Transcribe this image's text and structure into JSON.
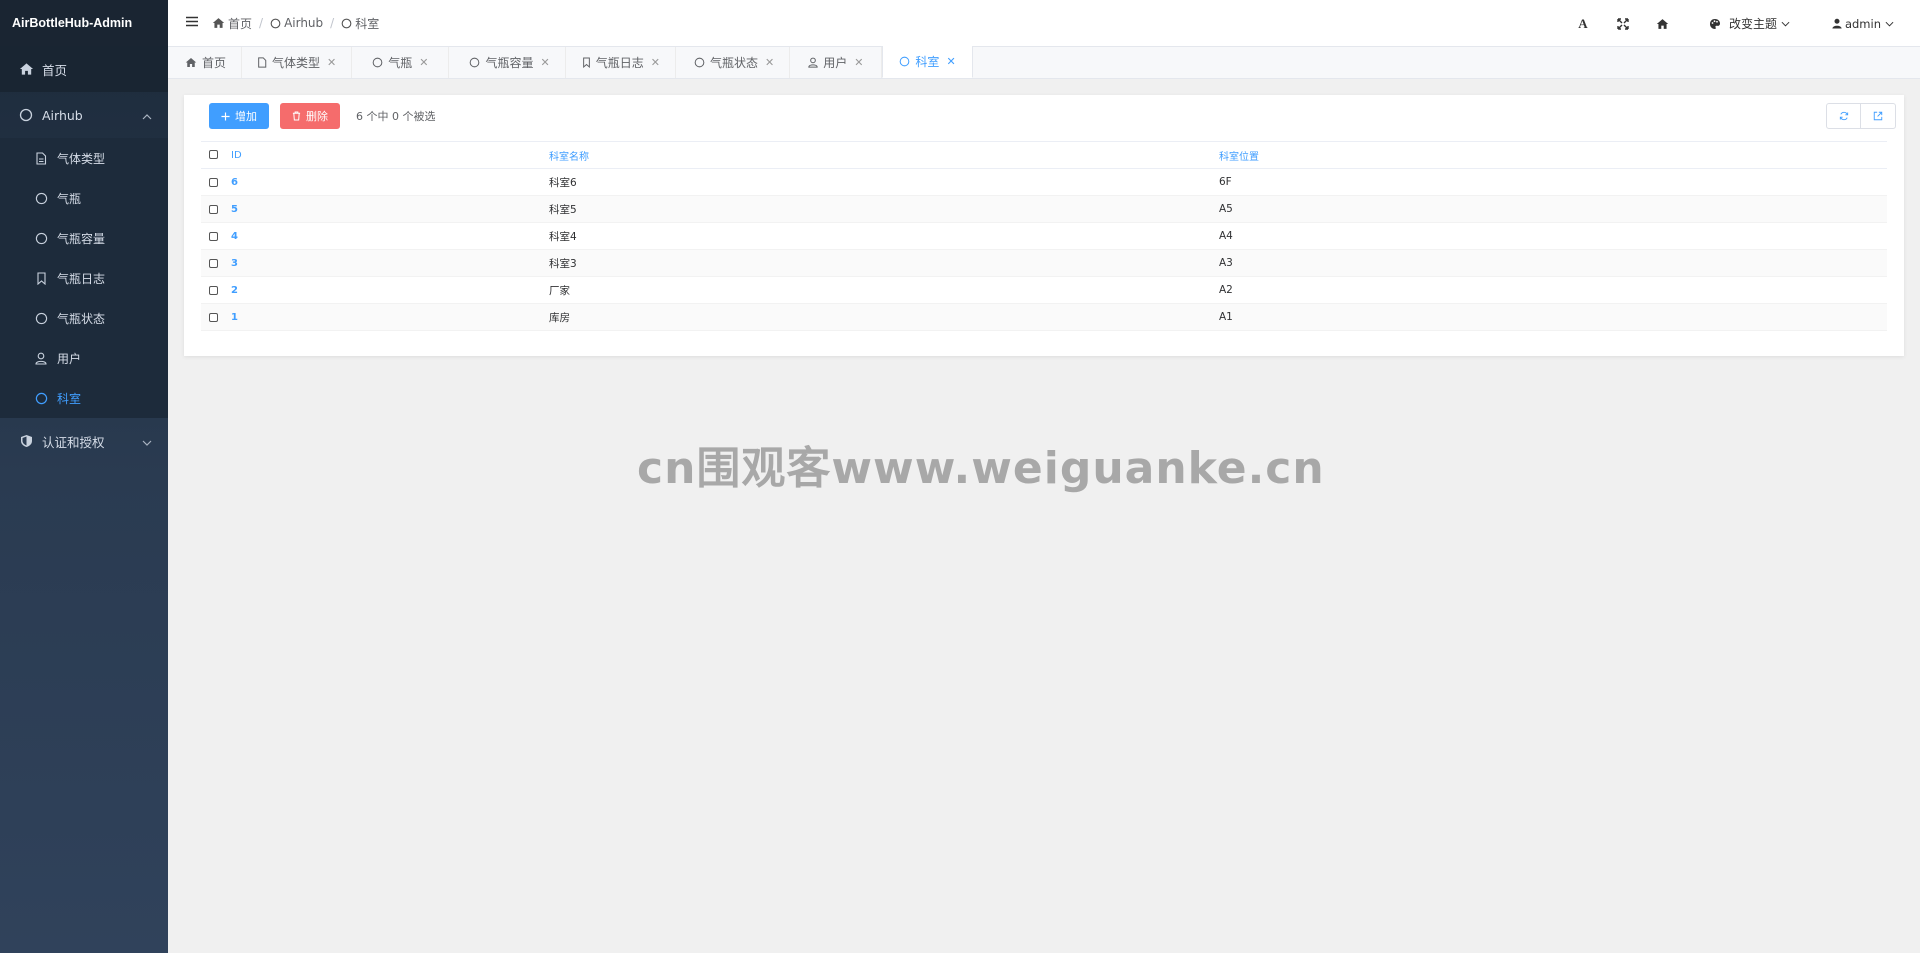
{
  "app": {
    "title": "AirBottleHub-Admin"
  },
  "sidebar": {
    "home_label": "首页",
    "airhub_label": "Airhub",
    "airhub_items": [
      {
        "label": "气体类型",
        "icon": "document-icon"
      },
      {
        "label": "气瓶",
        "icon": "circle-icon"
      },
      {
        "label": "气瓶容量",
        "icon": "circle-icon"
      },
      {
        "label": "气瓶日志",
        "icon": "bookmark-icon"
      },
      {
        "label": "气瓶状态",
        "icon": "circle-icon"
      },
      {
        "label": "用户",
        "icon": "user-icon"
      },
      {
        "label": "科室",
        "icon": "circle-icon"
      }
    ],
    "active_item": "科室",
    "auth_label": "认证和授权"
  },
  "header": {
    "breadcrumb": [
      "首页",
      "Airhub",
      "科室"
    ],
    "theme_label": "改变主题",
    "user_label": "admin"
  },
  "tabs": [
    {
      "label": "首页",
      "icon": "home-icon"
    },
    {
      "label": "气体类型",
      "icon": "document-icon"
    },
    {
      "label": "气瓶",
      "icon": "circle-icon"
    },
    {
      "label": "气瓶容量",
      "icon": "circle-icon"
    },
    {
      "label": "气瓶日志",
      "icon": "bookmark-icon"
    },
    {
      "label": "气瓶状态",
      "icon": "circle-icon"
    },
    {
      "label": "用户",
      "icon": "user-icon"
    },
    {
      "label": "科室",
      "icon": "circle-icon"
    }
  ],
  "toolbar": {
    "add_label": "增加",
    "delete_label": "删除",
    "selection_info": "6 个中 0 个被选"
  },
  "table": {
    "columns": [
      "ID",
      "科室名称",
      "科室位置"
    ],
    "rows": [
      {
        "id": "6",
        "name": "科室6",
        "location": "6F"
      },
      {
        "id": "5",
        "name": "科室5",
        "location": "A5"
      },
      {
        "id": "4",
        "name": "科室4",
        "location": "A4"
      },
      {
        "id": "3",
        "name": "科室3",
        "location": "A3"
      },
      {
        "id": "2",
        "name": "厂家",
        "location": "A2"
      },
      {
        "id": "1",
        "name": "库房",
        "location": "A1"
      }
    ]
  },
  "watermark": "cn围观客www.weiguanke.cn",
  "colors": {
    "accent": "#409eff",
    "danger": "#f56c6c",
    "sidebar_bg": "#2a3b51"
  }
}
